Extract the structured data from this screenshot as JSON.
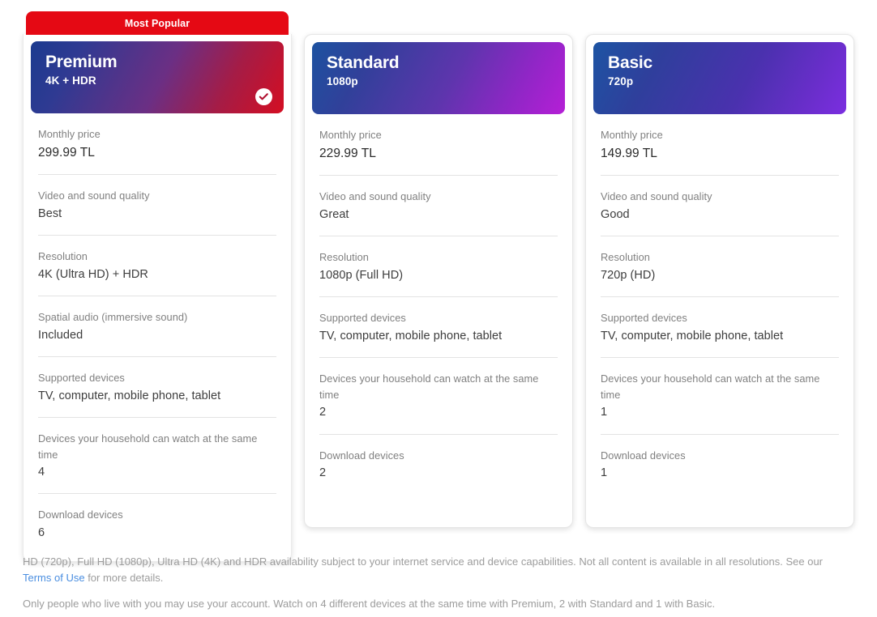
{
  "ribbon": {
    "label": "Most Popular"
  },
  "plans": [
    {
      "name": "Premium",
      "quality": "4K + HDR",
      "selected": true,
      "featured": true,
      "badge_icon": "check-circle-icon",
      "features": [
        {
          "label": "Monthly price",
          "value": "299.99 TL"
        },
        {
          "label": "Video and sound quality",
          "value": "Best"
        },
        {
          "label": "Resolution",
          "value": "4K (Ultra HD) + HDR"
        },
        {
          "label": "Spatial audio (immersive sound)",
          "value": "Included"
        },
        {
          "label": "Supported devices",
          "value": "TV, computer, mobile phone, tablet"
        },
        {
          "label": "Devices your household can watch at the same time",
          "value": "4"
        },
        {
          "label": "Download devices",
          "value": "6"
        }
      ]
    },
    {
      "name": "Standard",
      "quality": "1080p",
      "selected": false,
      "featured": false,
      "features": [
        {
          "label": "Monthly price",
          "value": "229.99 TL"
        },
        {
          "label": "Video and sound quality",
          "value": "Great"
        },
        {
          "label": "Resolution",
          "value": "1080p (Full HD)"
        },
        {
          "label": "Supported devices",
          "value": "TV, computer, mobile phone, tablet"
        },
        {
          "label": "Devices your household can watch at the same time",
          "value": "2"
        },
        {
          "label": "Download devices",
          "value": "2"
        }
      ]
    },
    {
      "name": "Basic",
      "quality": "720p",
      "selected": false,
      "featured": false,
      "features": [
        {
          "label": "Monthly price",
          "value": "149.99 TL"
        },
        {
          "label": "Video and sound quality",
          "value": "Good"
        },
        {
          "label": "Resolution",
          "value": "720p (HD)"
        },
        {
          "label": "Supported devices",
          "value": "TV, computer, mobile phone, tablet"
        },
        {
          "label": "Devices your household can watch at the same time",
          "value": "1"
        },
        {
          "label": "Download devices",
          "value": "1"
        }
      ]
    }
  ],
  "footer": {
    "line1_before_link": "HD (720p), Full HD (1080p), Ultra HD (4K) and HDR availability subject to your internet service and device capabilities. Not all content is available in all resolutions. See our ",
    "link_label": "Terms of Use",
    "line1_after_link": " for more details.",
    "line2": "Only people who live with you may use your account. Watch on 4 different devices at the same time with Premium, 2 with Standard and 1 with Basic."
  },
  "colors": {
    "ribbon_red": "#e50914",
    "link_blue": "#4a8ee0",
    "label_gray": "#808080",
    "value_gray": "#3d3d3d",
    "footer_gray": "#9c9c9c",
    "divider": "#e3e3e3"
  }
}
